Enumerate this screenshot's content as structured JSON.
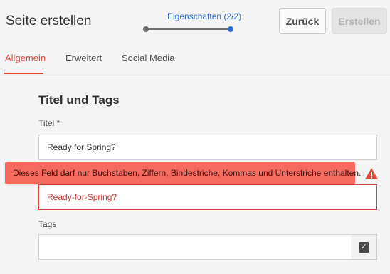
{
  "header": {
    "title": "Seite erstellen",
    "wizard": {
      "step_label": "Eigenschaften (2/2)",
      "current_step": 2,
      "total_steps": 2
    },
    "back_label": "Zurück",
    "create_label": "Erstellen"
  },
  "tabs": [
    {
      "label": "Allgemein",
      "active": true
    },
    {
      "label": "Erweitert",
      "active": false
    },
    {
      "label": "Social Media",
      "active": false
    }
  ],
  "form": {
    "section_title": "Titel und Tags",
    "title_label": "Titel *",
    "title_value": "Ready for Spring?",
    "name_value": "Ready-for-Spring?",
    "error_message": "Dieses Feld darf nur Buchstaben, Ziffern, Bindestriche, Kommas und Unterstriche enthalten.",
    "tags_label": "Tags",
    "tags_value": ""
  },
  "colors": {
    "accent": "#2d6dd6",
    "active_tab": "#e1493a",
    "error": "#f56b5f",
    "error_border": "#e1493a"
  },
  "icons": [
    "warning-icon",
    "checkbox-icon"
  ]
}
